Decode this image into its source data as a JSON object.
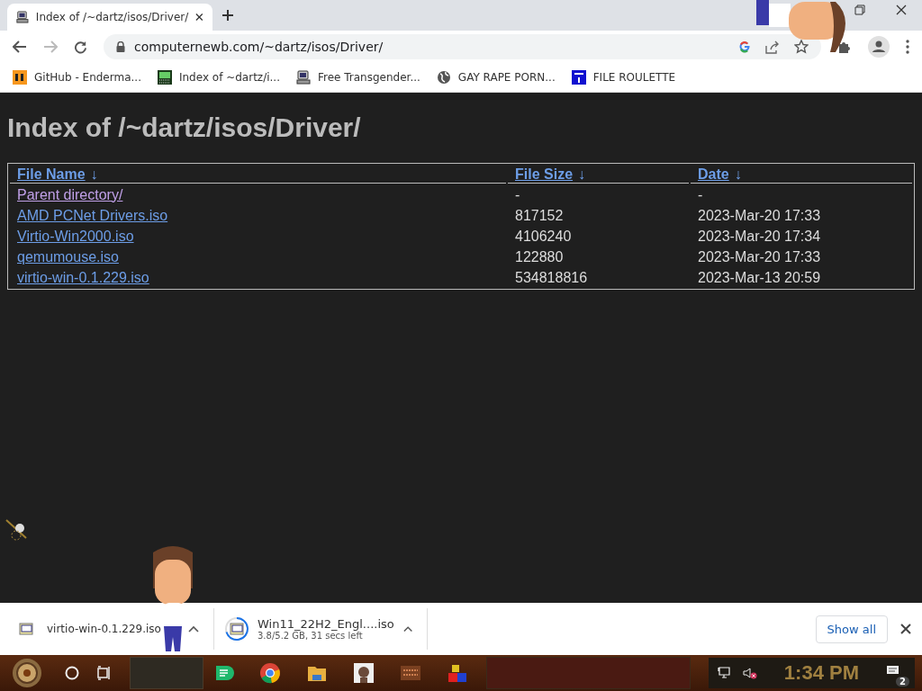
{
  "browser": {
    "tabs": [
      {
        "title": "Index of /~dartz/isos/Driver/",
        "selected": true
      }
    ],
    "address": "computernewb.com/~dartz/isos/Driver/",
    "bookmarks": [
      {
        "label": "GitHub - Enderma..."
      },
      {
        "label": "Index of ~dartz/i..."
      },
      {
        "label": "Free Transgender..."
      },
      {
        "label": "GAY RAPE PORN..."
      },
      {
        "label": "FILE ROULETTE"
      }
    ]
  },
  "page": {
    "heading": "Index of /~dartz/isos/Driver/",
    "table": {
      "columns": [
        {
          "label": "File Name",
          "sort_mark": "↓"
        },
        {
          "label": "File Size",
          "sort_mark": "↓"
        },
        {
          "label": "Date",
          "sort_mark": "↓"
        }
      ],
      "rows": [
        {
          "name": "Parent directory/",
          "visited": true,
          "size": "-",
          "date": "-"
        },
        {
          "name": "AMD PCNet Drivers.iso",
          "visited": false,
          "size": "817152",
          "date": "2023-Mar-20 17:33"
        },
        {
          "name": "Virtio-Win2000.iso",
          "visited": false,
          "size": "4106240",
          "date": "2023-Mar-20 17:34"
        },
        {
          "name": "qemumouse.iso",
          "visited": false,
          "size": "122880",
          "date": "2023-Mar-20 17:33"
        },
        {
          "name": "virtio-win-0.1.229.iso",
          "visited": false,
          "size": "534818816",
          "date": "2023-Mar-13 20:59"
        }
      ]
    }
  },
  "downloads": {
    "items": [
      {
        "name": "virtio-win-0.1.229.iso",
        "in_progress": false
      },
      {
        "name": "Win11_22H2_Engl....iso",
        "status": "3.8/5.2 GB, 31 secs left",
        "in_progress": true
      }
    ],
    "show_all": "Show all"
  },
  "taskbar": {
    "clock": "1:34 PM",
    "notification_count": "2"
  }
}
